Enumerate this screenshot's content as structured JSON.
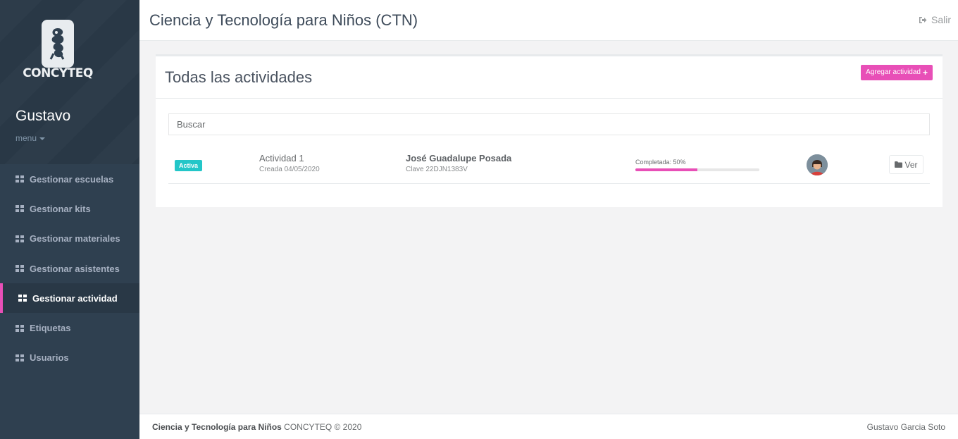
{
  "sidebar": {
    "logo_text": "CONCYTEQ",
    "user_name": "Gustavo",
    "user_menu": "menu",
    "items": [
      {
        "label": "Gestionar escuelas",
        "active": false
      },
      {
        "label": "Gestionar kits",
        "active": false
      },
      {
        "label": "Gestionar materiales",
        "active": false
      },
      {
        "label": "Gestionar asistentes",
        "active": false
      },
      {
        "label": "Gestionar actividad",
        "active": true
      },
      {
        "label": "Etiquetas",
        "active": false
      },
      {
        "label": "Usuarios",
        "active": false
      }
    ]
  },
  "header": {
    "title": "Ciencia y Tecnología para Niños (CTN)",
    "logout_label": "Salir"
  },
  "main": {
    "title": "Todas las actividades",
    "add_button": "Agregar actividad",
    "search_placeholder": "Buscar",
    "activities": [
      {
        "status": "Activa",
        "name": "Actividad 1",
        "created": "Creada 04/05/2020",
        "school": "José Guadalupe Posada",
        "clave": "Clave 22DJN1383V",
        "progress_label": "Completada: 50%",
        "progress_percent": 50,
        "view_label": "Ver"
      }
    ]
  },
  "footer": {
    "brand": "Ciencia y Tecnología para Niños",
    "copyright": "CONCYTEQ © 2020",
    "author": "Gustavo Garcia Soto"
  },
  "colors": {
    "sidebar_bg": "#2f4050",
    "accent": "#e84fb7",
    "badge_active": "#23c6c8"
  },
  "icons": {
    "nav": "th-large-icon",
    "logout": "sign-out-icon",
    "add": "plus-icon",
    "view": "folder-icon"
  }
}
